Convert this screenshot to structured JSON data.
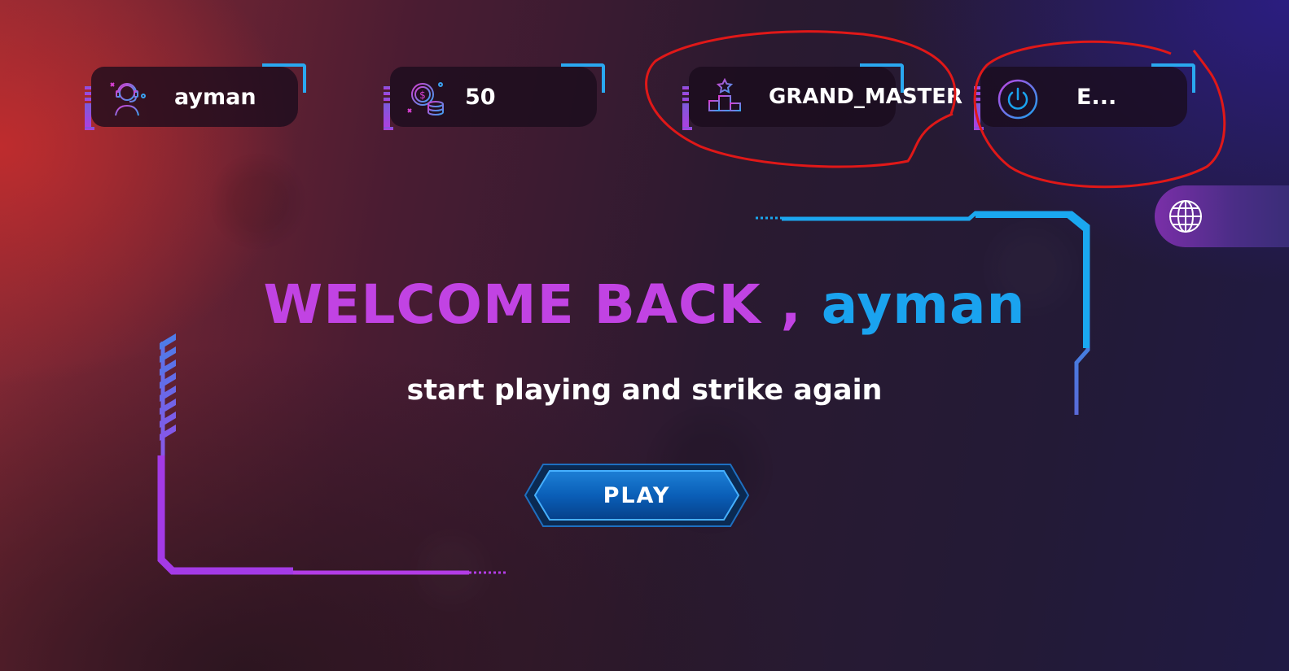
{
  "stats": {
    "username": "ayman",
    "coins": "50",
    "rank": "GRAND_MASTER",
    "logout": "E..."
  },
  "welcome": {
    "prefix": "WELCOME BACK ,",
    "name": "ayman",
    "subtitle": "start playing and strike again"
  },
  "play_button": {
    "label": "PLAY"
  },
  "icons": {
    "user": "gamer-headset-icon",
    "coins": "coins-icon",
    "rank": "podium-icon",
    "logout": "power-icon",
    "language": "globe-icon"
  },
  "colors": {
    "accent_blue": "#1aa3ef",
    "accent_purple": "#c143e3",
    "annotation_red": "#e01818"
  }
}
